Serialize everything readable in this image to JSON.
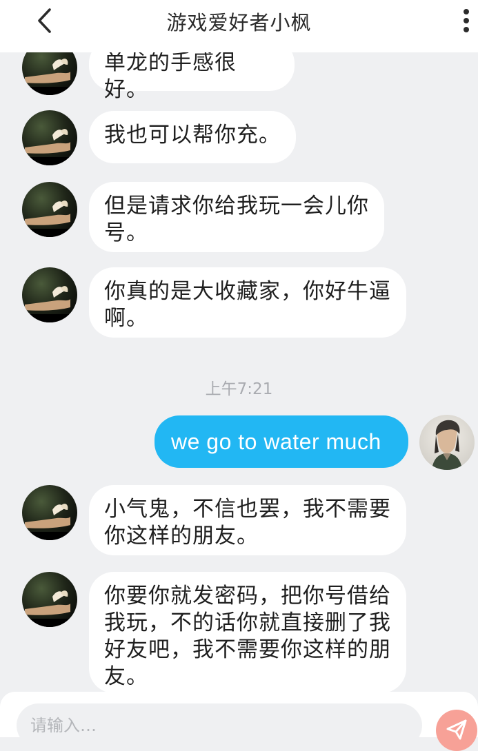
{
  "header": {
    "title": "游戏爱好者小枫",
    "back_icon": "chevron-left-icon",
    "more_icon": "more-vertical-icon"
  },
  "messages": [
    {
      "sender": "friend",
      "text": "单龙的手感很好。"
    },
    {
      "sender": "friend",
      "text": "我也可以帮你充。"
    },
    {
      "sender": "friend",
      "text": "但是请求你给我玩一会儿你号。"
    },
    {
      "sender": "friend",
      "text": "你真的是大收藏家，你好牛逼啊。"
    },
    {
      "sender": "self",
      "text": "we go to water much"
    },
    {
      "sender": "friend",
      "text": "小气鬼，不信也罢，我不需要你这样的朋友。"
    },
    {
      "sender": "friend",
      "text": "你要你就发密码，把你号借给我玩，不的话你就直接删了我好友吧，我不需要你这样的朋友。"
    }
  ],
  "timestamp": "上午7:21",
  "input": {
    "placeholder": "请输入…",
    "value": ""
  },
  "send_icon": "send-plane-icon",
  "colors": {
    "self_bubble": "#22b7f3",
    "friend_bubble": "#ffffff",
    "background": "#eff0f2",
    "send_button": "#f7a197",
    "timestamp": "#a9abb0"
  }
}
